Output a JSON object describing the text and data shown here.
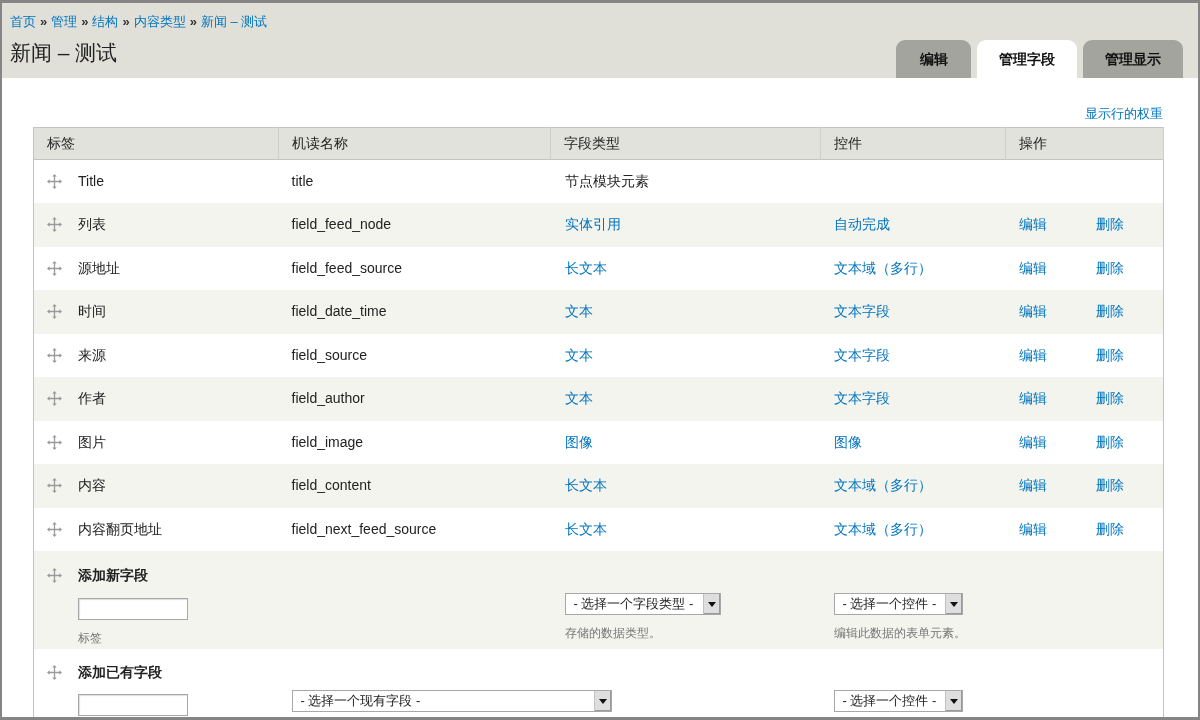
{
  "breadcrumb": [
    {
      "label": "首页",
      "separator": "»"
    },
    {
      "label": "管理",
      "separator": "»"
    },
    {
      "label": "结构",
      "separator": "»"
    },
    {
      "label": "内容类型",
      "separator": "»"
    },
    {
      "label": "新闻 – 测试"
    }
  ],
  "page_title": "新闻 – 测试",
  "tabs": [
    {
      "label": "编辑",
      "selected": false
    },
    {
      "label": "管理字段",
      "selected": true
    },
    {
      "label": "管理显示",
      "selected": false
    }
  ],
  "weights_link": "显示行的权重",
  "table": {
    "columns": [
      "标签",
      "机读名称",
      "字段类型",
      "控件",
      "操作"
    ],
    "rows": [
      {
        "kind": "locked",
        "label": "Title",
        "machine_name": "title",
        "field_type": "节点模块元素"
      },
      {
        "kind": "field",
        "label": "列表",
        "machine_name": "field_feed_node",
        "field_type": "实体引用",
        "widget": "自动完成",
        "operations": [
          "编辑",
          "删除"
        ]
      },
      {
        "kind": "field",
        "label": "源地址",
        "machine_name": "field_feed_source",
        "field_type": "长文本",
        "widget": "文本域（多行）",
        "operations": [
          "编辑",
          "删除"
        ]
      },
      {
        "kind": "field",
        "label": "时间",
        "machine_name": "field_date_time",
        "field_type": "文本",
        "widget": "文本字段",
        "operations": [
          "编辑",
          "删除"
        ]
      },
      {
        "kind": "field",
        "label": "来源",
        "machine_name": "field_source",
        "field_type": "文本",
        "widget": "文本字段",
        "operations": [
          "编辑",
          "删除"
        ]
      },
      {
        "kind": "field",
        "label": "作者",
        "machine_name": "field_author",
        "field_type": "文本",
        "widget": "文本字段",
        "operations": [
          "编辑",
          "删除"
        ]
      },
      {
        "kind": "field",
        "label": "图片",
        "machine_name": "field_image",
        "field_type": "图像",
        "widget": "图像",
        "operations": [
          "编辑",
          "删除"
        ]
      },
      {
        "kind": "field",
        "label": "内容",
        "machine_name": "field_content",
        "field_type": "长文本",
        "widget": "文本域（多行）",
        "operations": [
          "编辑",
          "删除"
        ]
      },
      {
        "kind": "field",
        "label": "内容翻页地址",
        "machine_name": "field_next_feed_source",
        "field_type": "长文本",
        "widget": "文本域（多行）",
        "operations": [
          "编辑",
          "删除"
        ]
      }
    ]
  },
  "add_new_field": {
    "title": "添加新字段",
    "label_hint": "标签",
    "type_select": "- 选择一个字段类型 -",
    "type_hint": "存储的数据类型。",
    "widget_select": "- 选择一个控件 -",
    "widget_hint": "编辑此数据的表单元素。"
  },
  "add_existing_field": {
    "title": "添加已有字段",
    "field_select": "- 选择一个现有字段 -",
    "widget_select": "- 选择一个控件 -"
  }
}
